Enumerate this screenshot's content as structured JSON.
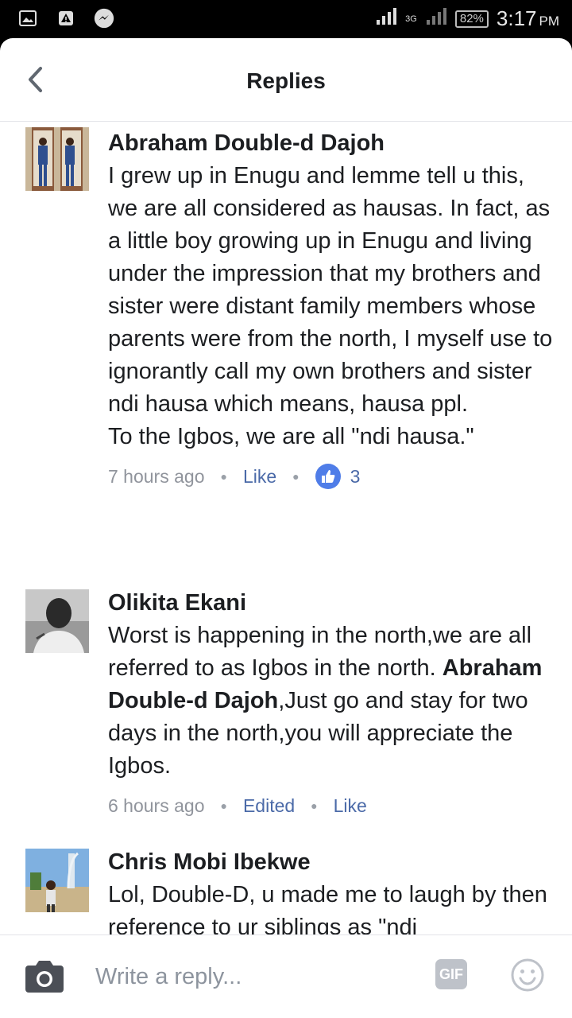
{
  "status_bar": {
    "network": "3G",
    "battery": "82%",
    "time": "3:17",
    "time_suffix": "PM"
  },
  "header": {
    "title": "Replies"
  },
  "comments": [
    {
      "author": "Abraham Double-d Dajoh",
      "lines": [
        "I grew up in Enugu and lemme tell u this, we are all considered as hausas. In fact, as a little boy growing up in Enugu and living under the impression that my brothers and sister were distant family members whose parents were from the north, I myself use to ignorantly call my own brothers and sister ndi hausa which means, hausa ppl.",
        "To the Igbos, we are all \"ndi hausa.\""
      ],
      "time": "7 hours ago",
      "like_label": "Like",
      "like_count": "3"
    },
    {
      "author": "Olikita Ekani",
      "text_before": "Worst is happening in the north,we are all referred to as Igbos in the north. ",
      "mention": "Abraham Double-d Dajoh",
      "text_after": ",Just go and stay for two days in the north,you will appreciate the Igbos.",
      "time": "6 hours ago",
      "edited_label": "Edited",
      "like_label": "Like"
    },
    {
      "author": "Chris Mobi Ibekwe",
      "text": "Lol, Double-D, u made me to laugh by then reference to ur siblings as \"ndi"
    }
  ],
  "composer": {
    "placeholder": "Write a reply...",
    "gif_label": "GIF"
  }
}
